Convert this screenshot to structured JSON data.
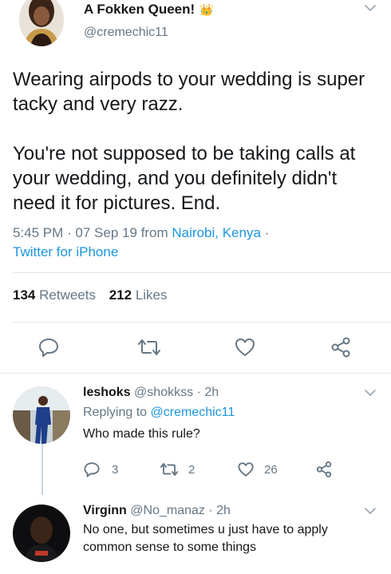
{
  "main_tweet": {
    "display_name": "A Fokken Queen!",
    "name_emoji": "👑",
    "handle": "@cremechic11",
    "text_para1": "Wearing airpods to your wedding is super tacky and very razz.",
    "text_para2": "You're not supposed to be taking calls at your wedding, and you definitely didn't need it for pictures. End.",
    "time": "5:45 PM · 07 Sep 19 from ",
    "location": "Nairobi, Kenya",
    "sep": " ·",
    "client": "Twitter for iPhone",
    "retweets_count": "134",
    "retweets_label": "Retweets",
    "likes_count": "212",
    "likes_label": "Likes"
  },
  "replies": [
    {
      "display_name": "leshoks",
      "handle": "@shokkss",
      "time": "· 2h",
      "replying_to_label": "Replying to ",
      "replying_to_handle": "@cremechic11",
      "text": "Who made this rule?",
      "reply_count": "3",
      "retweet_count": "2",
      "like_count": "26"
    },
    {
      "display_name": "Virginn",
      "handle": "@No_manaz",
      "time": "· 2h",
      "text": "No one, but sometimes u just have to apply common sense to some things"
    }
  ],
  "colors": {
    "text": "#14171a",
    "muted": "#657786",
    "link": "#1b95e0",
    "divider": "#e1e8ed",
    "icon": "#657786"
  },
  "icons": [
    "chevron-down-icon",
    "reply-icon",
    "retweet-icon",
    "like-icon",
    "share-icon",
    "crown-icon"
  ]
}
